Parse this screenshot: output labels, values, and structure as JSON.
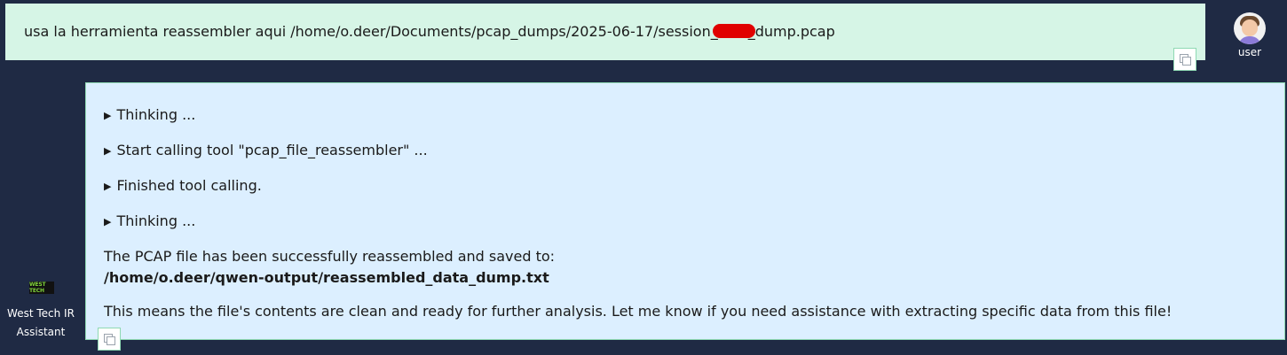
{
  "user_message": {
    "text_before": "usa la herramienta reassembler aqui /home/o.deer/Documents/pcap_dumps/2025-06-17/session_",
    "text_after": "_dump.pcap"
  },
  "user": {
    "label": "user",
    "avatar_icon": "user-avatar-icon"
  },
  "assistant": {
    "steps": [
      "Thinking ...",
      "Start calling tool \"pcap_file_reassembler\" ...",
      "Finished tool calling.",
      "Thinking ..."
    ],
    "result_text": "The PCAP file has been successfully reassembled and saved to:",
    "result_path": "/home/o.deer/qwen-output/reassembled_data_dump.txt",
    "closing_text": "This means the file's contents are clean and ready for further analysis. Let me know if you need assistance with extracting specific data from this file!",
    "name_line1": "West Tech IR",
    "name_line2": "Assistant",
    "logo_text": "WEST TECH"
  },
  "colors": {
    "background": "#1f2a44",
    "user_bubble": "#d6f5e6",
    "assistant_bubble": "#dcefff",
    "redaction": "#e00000"
  }
}
